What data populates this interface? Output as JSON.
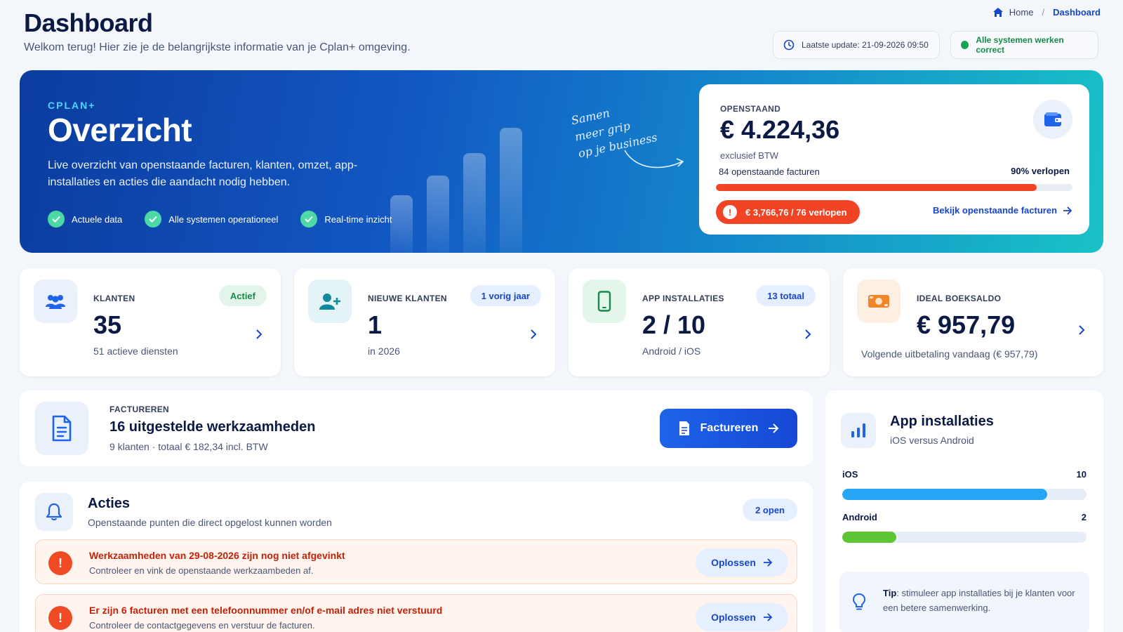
{
  "header": {
    "title": "Dashboard",
    "subtitle": "Welkom terug! Hier zie je de belangrijkste informatie van je Cplan+ omgeving.",
    "breadcrumb": {
      "home": "Home",
      "separator": "/",
      "current": "Dashboard"
    },
    "last_update": "Laatste update: 21-09-2026 09:50",
    "system_status": "Alle systemen werken correct"
  },
  "hero": {
    "brand": "CPLAN+",
    "title": "Overzicht",
    "description": "Live overzicht van openstaande facturen, klanten, omzet, app-installaties en acties die aandacht nodig hebben.",
    "checks": [
      "Actuele data",
      "Alle systemen operationeel",
      "Real-time inzicht"
    ],
    "slogan": [
      "Samen",
      "meer grip",
      "op je business"
    ],
    "card": {
      "label": "OPENSTAAND",
      "amount": "€ 4.224,36",
      "note": "exclusief BTW",
      "count": "84 openstaande facturen",
      "percent_label": "90% verlopen",
      "progress": 90,
      "expired": "€ 3,766,76 / 76 verlopen",
      "link": "Bekijk openstaande facturen"
    }
  },
  "stats": [
    {
      "label": "KLANTEN",
      "value": "35",
      "sub": "51 actieve diensten",
      "badge": "Actief",
      "icon": "users-icon"
    },
    {
      "label": "NIEUWE KLANTEN",
      "value": "1",
      "sub": "in 2026",
      "badge": "1 vorig jaar",
      "icon": "user-plus-icon"
    },
    {
      "label": "APP INSTALLATIES",
      "value": "2 / 10",
      "sub": "Android / iOS",
      "badge": "13 totaal",
      "icon": "phone-icon"
    },
    {
      "label": "IDEAL BOEKSALDO",
      "value": "€ 957,79",
      "sub": "Volgende uitbetaling vandaag (€ 957,79)",
      "icon": "money-icon"
    }
  ],
  "factureren": {
    "label": "FACTUREREN",
    "title": "16 uitgestelde werkzaamheden",
    "sub": "9 klanten · totaal € 182,34 incl. BTW",
    "button": "Factureren"
  },
  "acties": {
    "title": "Acties",
    "sub": "Openstaande punten die direct opgelost kunnen worden",
    "badge": "2 open",
    "items": [
      {
        "title": "Werkzaamheden van 29-08-2026 zijn nog niet afgevinkt",
        "sub": "Controleer en vink de openstaande werkzaambeden af.",
        "button": "Oplossen"
      },
      {
        "title": "Er zijn 6 facturen met een telefoonnummer en/of e-mail adres niet verstuurd",
        "sub": "Controleer de contactgegevens en verstuur de facturen.",
        "button": "Oplossen"
      }
    ]
  },
  "app_installaties": {
    "title": "App installaties",
    "sub": "iOS versus Android",
    "rows": [
      {
        "label": "iOS",
        "value": "10",
        "fraction": 0.84,
        "color": "#26a6f2"
      },
      {
        "label": "Android",
        "value": "2",
        "fraction": 0.22,
        "color": "#5ec534"
      }
    ],
    "tip_label": "Tip",
    "tip_text": ": stimuleer app installaties bij je klanten voor een betere samenwerking."
  },
  "colors": {
    "primary": "#1746c9",
    "danger": "#f04424",
    "success": "#17a554"
  }
}
